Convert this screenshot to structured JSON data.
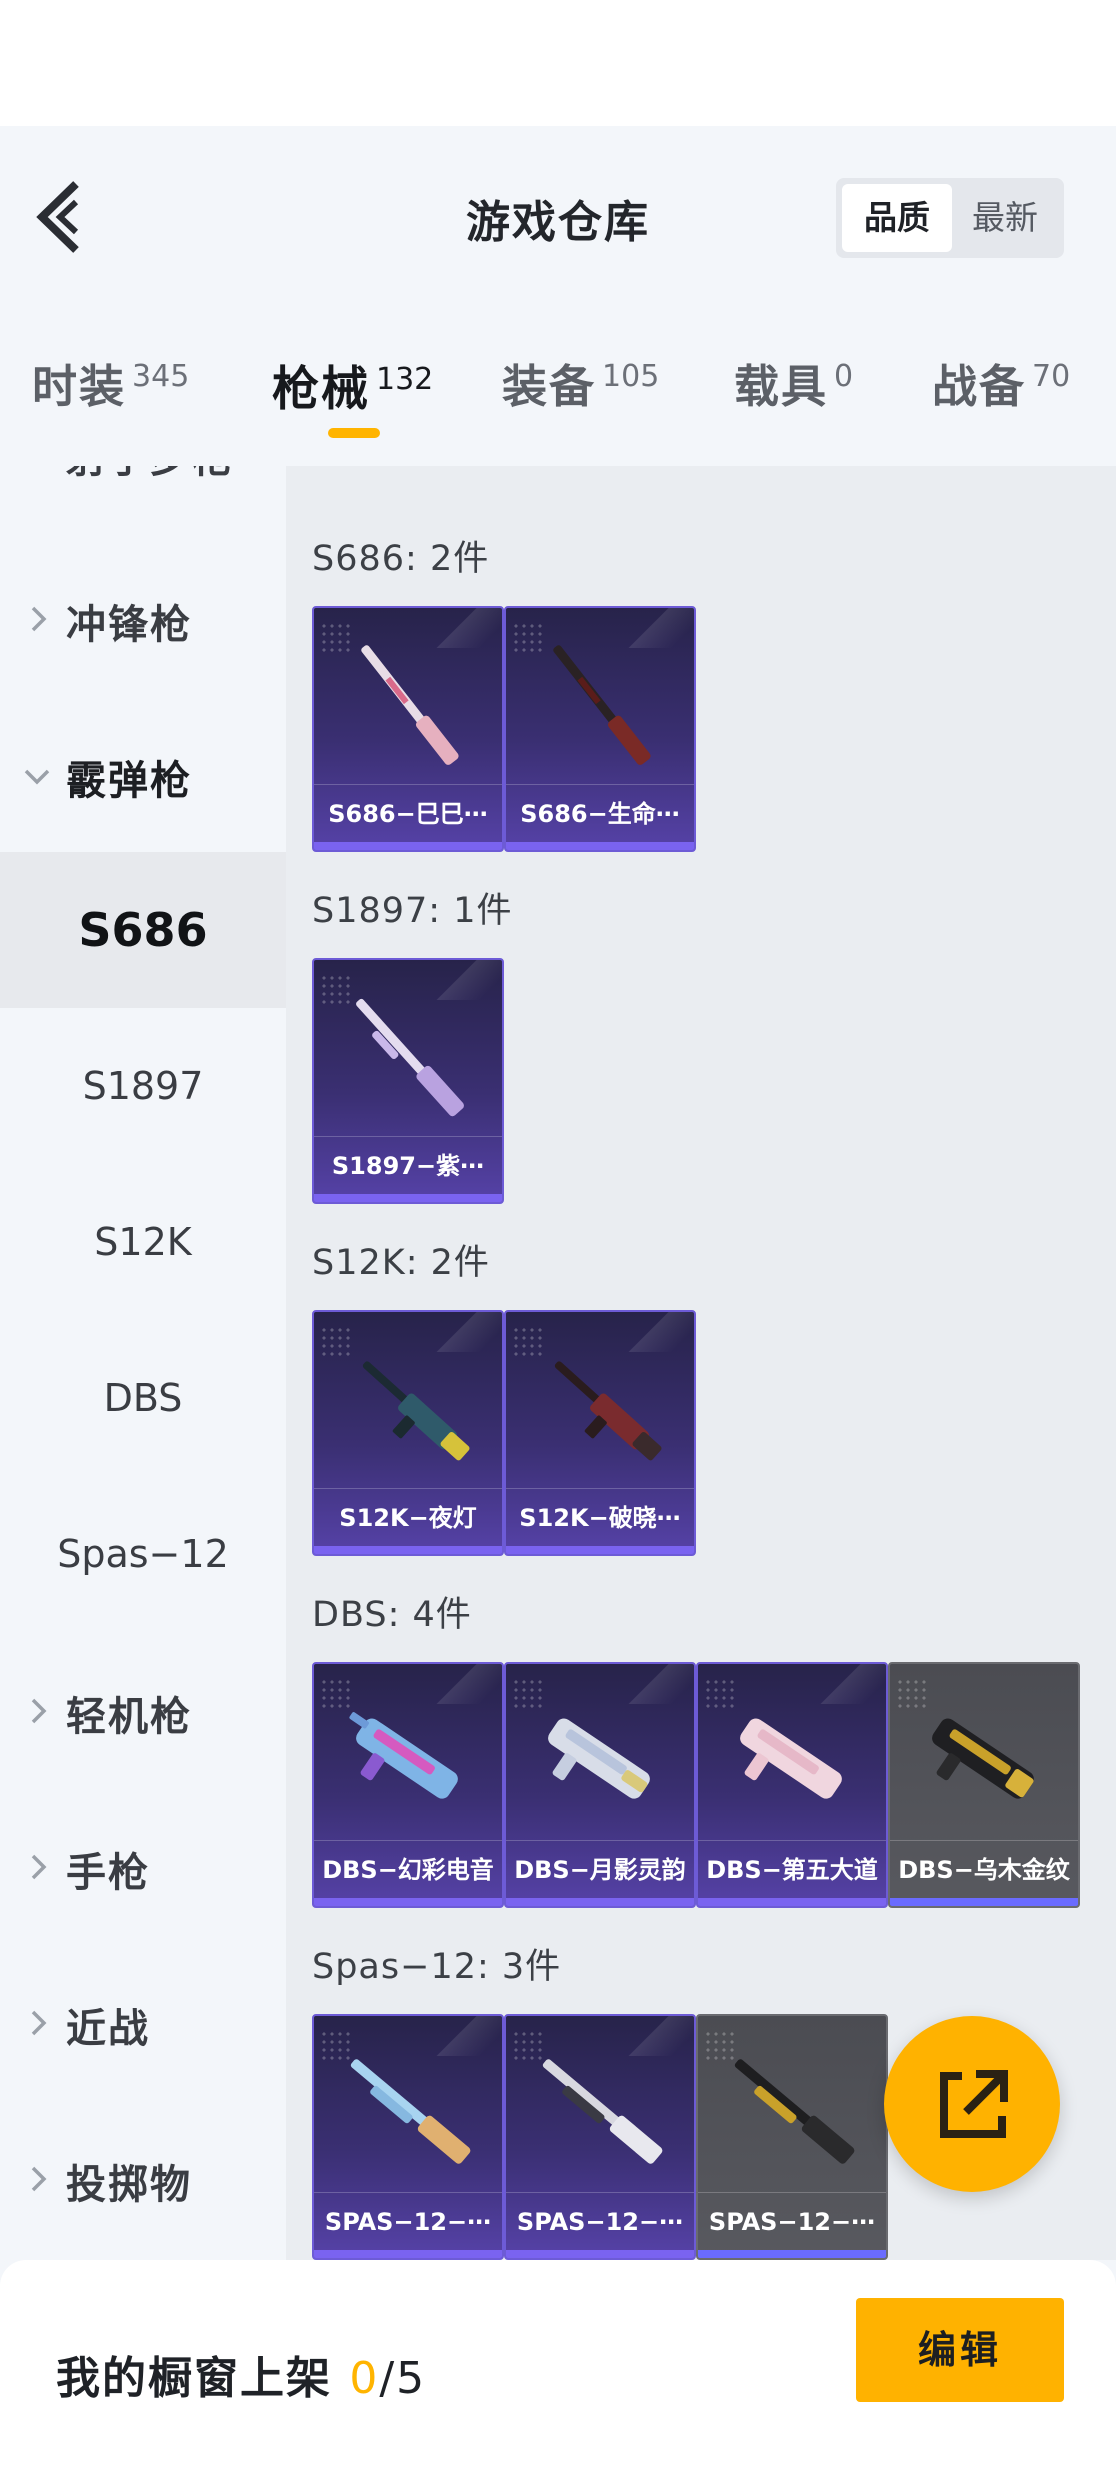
{
  "header": {
    "title": "游戏仓库",
    "sort_active": "品质",
    "sort_other": "最新"
  },
  "tabs": [
    {
      "label": "时装",
      "count": "345"
    },
    {
      "label": "枪械",
      "count": "132"
    },
    {
      "label": "装备",
      "count": "105"
    },
    {
      "label": "载具",
      "count": "0"
    },
    {
      "label": "战备",
      "count": "70"
    }
  ],
  "sidebar": {
    "cat_partial": "射手步枪",
    "cat_smg": "冲锋枪",
    "cat_shotgun": "霰弹枪",
    "sub_s686": "S686",
    "sub_s1897": "S1897",
    "sub_s12k": "S12K",
    "sub_dbs": "DBS",
    "sub_spas": "Spas−12",
    "cat_lmg": "轻机枪",
    "cat_pistol": "手枪",
    "cat_melee": "近战",
    "cat_throw": "投掷物"
  },
  "groups": {
    "s686": {
      "title": "S686: 2件",
      "items": [
        "S686−巳巳⋯",
        "S686−生命⋯"
      ]
    },
    "s1897": {
      "title": "S1897: 1件",
      "items": [
        "S1897−紫⋯"
      ]
    },
    "s12k": {
      "title": "S12K: 2件",
      "items": [
        "S12K−夜灯",
        "S12K−破晓⋯"
      ]
    },
    "dbs": {
      "title": "DBS: 4件",
      "items": [
        "DBS−幻彩电音",
        "DBS−月影灵韵",
        "DBS−第五大道",
        "DBS−乌木金纹"
      ]
    },
    "spas": {
      "title": "Spas−12: 3件",
      "items": [
        "SPAS−12−⋯",
        "SPAS−12−⋯",
        "SPAS−12−⋯"
      ]
    }
  },
  "bottom": {
    "label": "我的橱窗上架 ",
    "count": "0",
    "total": "/5",
    "edit": "编辑"
  },
  "colors": {
    "accent": "#ffb400",
    "card_purple": "#3a2f72",
    "card_gray": "#58595f"
  },
  "icons": {
    "back": "chevron-left-icon",
    "share": "external-link-icon"
  }
}
